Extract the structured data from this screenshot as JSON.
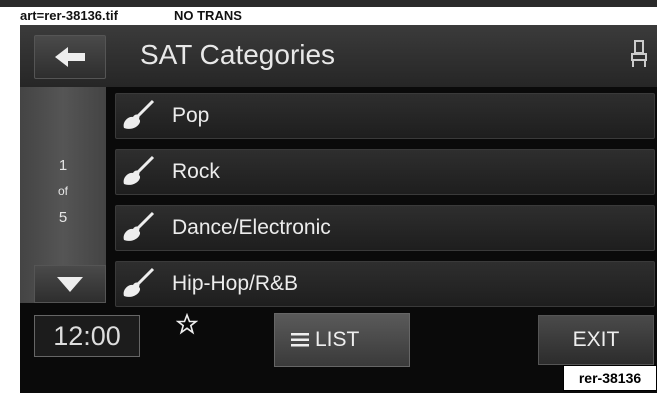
{
  "meta": {
    "art_label": "art=rer-38136.tif",
    "trans_label": "NO TRANS"
  },
  "header": {
    "title": "SAT Categories",
    "back_icon": "back-arrow-icon",
    "right_icon": "seat-icon"
  },
  "pager": {
    "current": "1",
    "of": "of",
    "total": "5"
  },
  "categories": [
    {
      "label": "Pop",
      "icon": "guitar-icon"
    },
    {
      "label": "Rock",
      "icon": "guitar-icon"
    },
    {
      "label": "Dance/Electronic",
      "icon": "guitar-icon"
    },
    {
      "label": "Hip-Hop/R&B",
      "icon": "guitar-icon"
    }
  ],
  "bottom": {
    "clock": "12:00",
    "list_label": "LIST",
    "exit_label": "EXIT"
  },
  "ref_tag": "rer-38136",
  "colors": {
    "background": "#0a0a0a",
    "button": "#3a3a3a",
    "text": "#e8e8e8"
  }
}
